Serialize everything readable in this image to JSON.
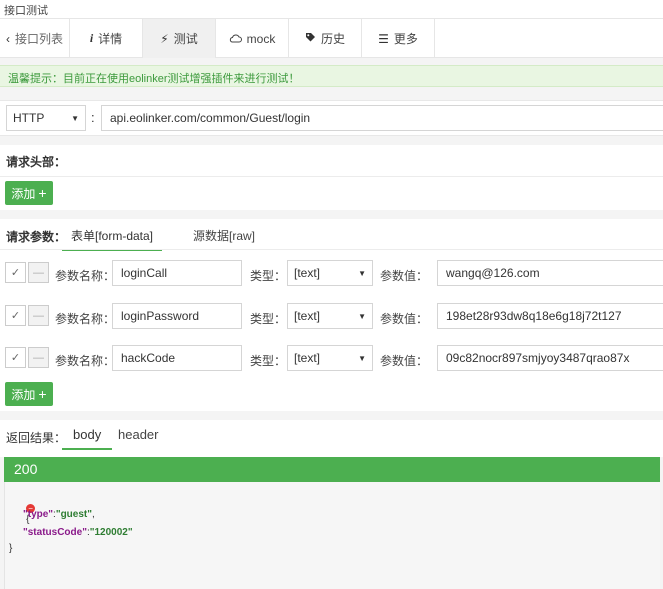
{
  "window_title": "接口测试",
  "tabs": {
    "back": "接口列表",
    "detail": "详情",
    "test": "测试",
    "mock": "mock",
    "history": "历史",
    "more": "更多"
  },
  "notice": "温馨提示：目前正在使用eolinker测试增强插件来进行测试！",
  "request": {
    "protocol": "HTTP",
    "url": "api.eolinker.com/common/Guest/login"
  },
  "headers_section": {
    "label": "请求头部：",
    "add_label": "添加"
  },
  "params_section": {
    "label": "请求参数：",
    "tab_form": "表单[form-data]",
    "tab_raw": "源数据[raw]",
    "name_label": "参数名称：",
    "type_label": "类型：",
    "value_label": "参数值：",
    "add_label": "添加",
    "params": [
      {
        "name": "loginCall",
        "type": "[text]",
        "value": "wangq@126.com"
      },
      {
        "name": "loginPassword",
        "type": "[text]",
        "value": "198et28r93dw8q18e6g18j72t127"
      },
      {
        "name": "hackCode",
        "type": "[text]",
        "value": "09c82nocr897smjyoy3487qrao87x"
      }
    ]
  },
  "result_section": {
    "label": "返回结果：",
    "tab_body": "body",
    "tab_header": "header",
    "status": "200",
    "json": {
      "open": "{",
      "k1": "\"type\"",
      "v1": "\"guest\"",
      "k2": "\"statusCode\"",
      "v2": "\"120002\"",
      "close": "}"
    }
  },
  "colors": {
    "accent": "#4caf50",
    "notice_text": "#3c9a3c",
    "json_key": "#8a1a8a",
    "json_string": "#2e7d32"
  }
}
